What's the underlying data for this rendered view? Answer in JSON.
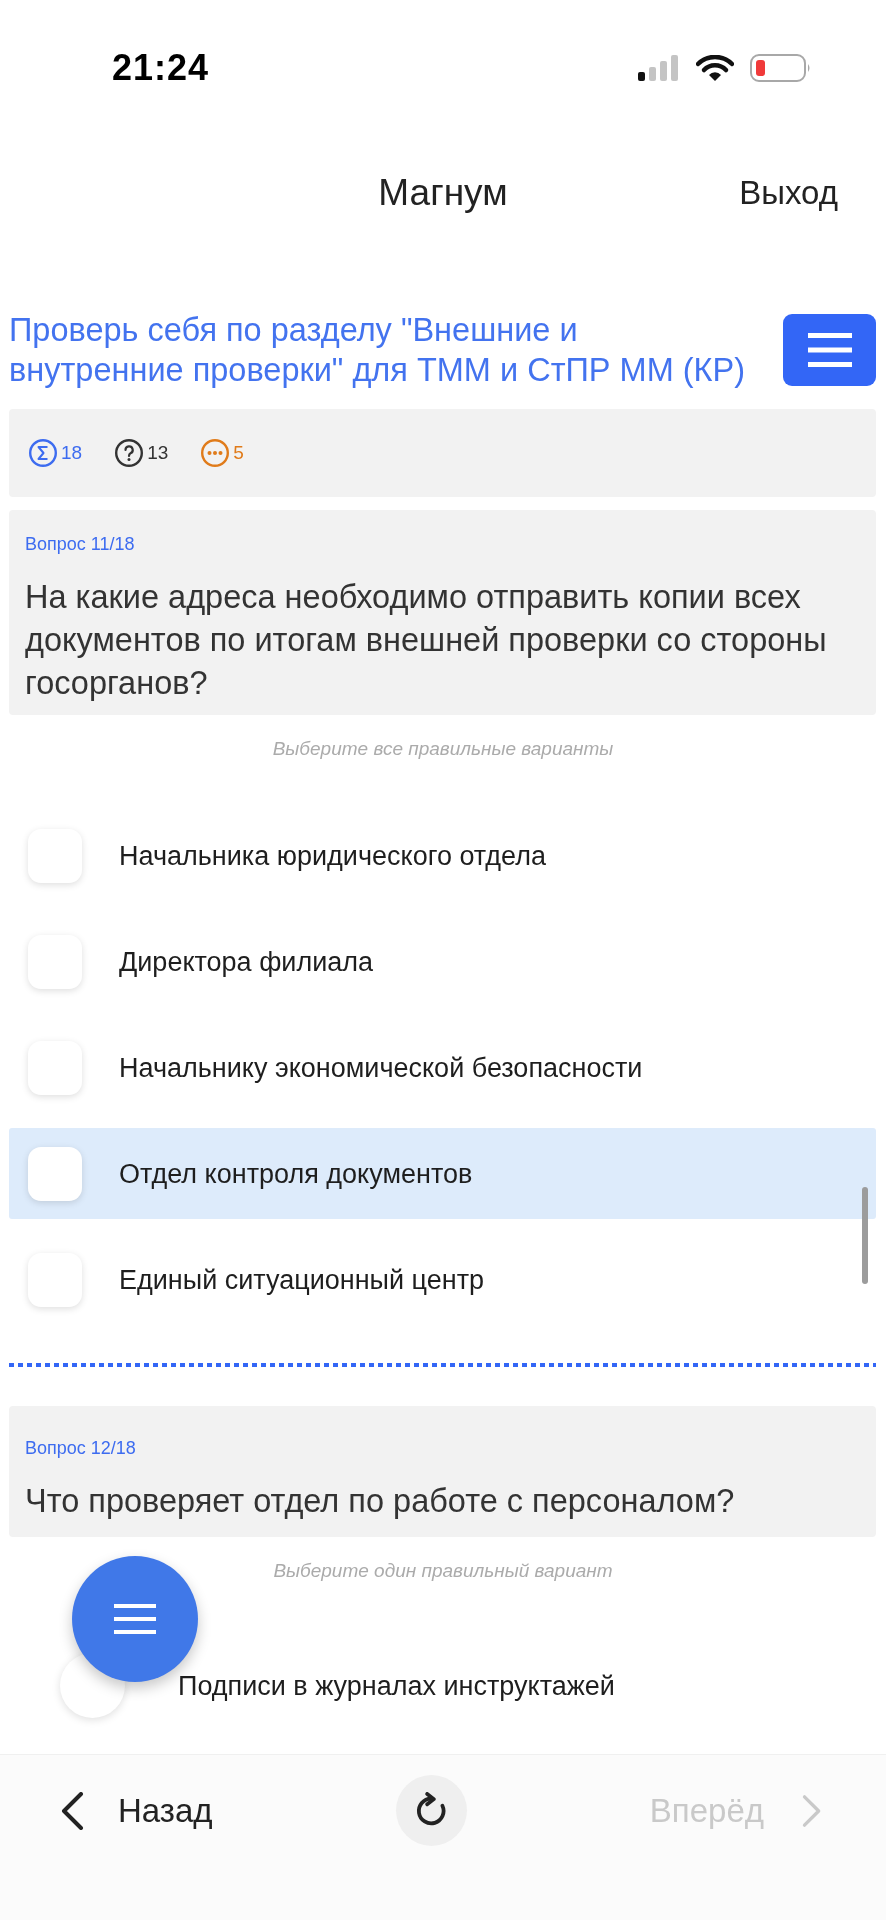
{
  "status_bar": {
    "time": "21:24"
  },
  "header": {
    "title": "Магнум",
    "exit_label": "Выход"
  },
  "test": {
    "title": "Проверь себя по разделу \"Внешние и внутренние проверки\" для ТММ и СтПР ММ (КР)"
  },
  "stats": [
    {
      "kind": "sigma",
      "value": "18",
      "color": "#3d6cf0"
    },
    {
      "kind": "question",
      "value": "13",
      "color": "#333333"
    },
    {
      "kind": "ellipsis",
      "value": "5",
      "color": "#e07b1a"
    }
  ],
  "questions": [
    {
      "label": "Вопрос 11/18",
      "text": "На какие адреса необходимо отправить копии всех документов по итогам внешней проверки со стороны госорганов?",
      "hint": "Выберите все правильные варианты",
      "kind": "multiple",
      "options": [
        {
          "text": "Начальника юридического отдела",
          "checked": false,
          "highlighted": false
        },
        {
          "text": "Директора филиала",
          "checked": false,
          "highlighted": false
        },
        {
          "text": "Начальнику экономической безопасности",
          "checked": false,
          "highlighted": false
        },
        {
          "text": "Отдел контроля документов",
          "checked": false,
          "highlighted": true
        },
        {
          "text": "Единый ситуационный центр",
          "checked": false,
          "highlighted": false
        }
      ]
    },
    {
      "label": "Вопрос 12/18",
      "text": "Что проверяет отдел по работе с персоналом?",
      "hint": "Выберите один правильный вариант",
      "kind": "single",
      "options": [
        {
          "text": "Подписи в журналах инструктажей",
          "checked": false,
          "highlighted": false
        }
      ]
    }
  ],
  "nav": {
    "back": {
      "label": "Назад",
      "disabled": false
    },
    "forward": {
      "label": "Вперёд",
      "disabled": true
    }
  }
}
